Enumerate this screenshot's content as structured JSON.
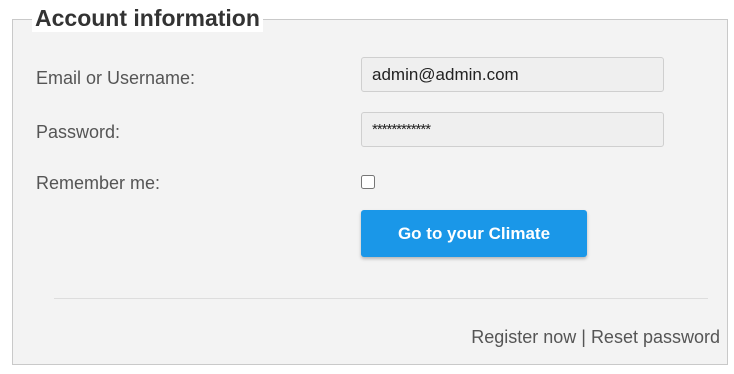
{
  "account": {
    "legend": "Account information",
    "email_label": "Email or Username:",
    "email_value": "admin@admin.com",
    "password_label": "Password:",
    "password_value": "************",
    "remember_label": "Remember me:",
    "remember_checked": false,
    "submit_label": "Go to your Climate"
  },
  "footer": {
    "register_label": "Register now",
    "separator": "|",
    "reset_label": "Reset password"
  },
  "colors": {
    "accent": "#1a97e8",
    "panel_bg": "#f3f3f3",
    "text": "#555555"
  }
}
